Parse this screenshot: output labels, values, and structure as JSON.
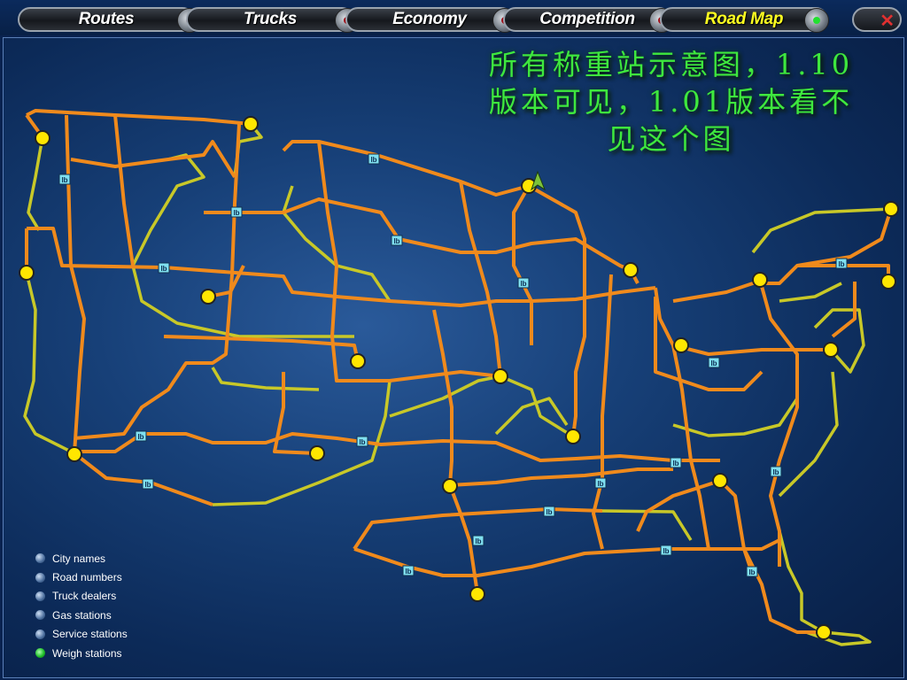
{
  "nav": {
    "tabs": [
      {
        "label": "Routes",
        "active": false
      },
      {
        "label": "Trucks",
        "active": false
      },
      {
        "label": "Economy",
        "active": false
      },
      {
        "label": "Competition",
        "active": false
      },
      {
        "label": "Road Map",
        "active": true
      }
    ],
    "close_icon": "close-icon"
  },
  "map": {
    "note": "所有称重站示意图，1.10版本可见，1.01版本看不见这个图",
    "weigh_label": "lb",
    "colors": {
      "interstate": "#f08a1c",
      "highway": "#c8c828",
      "city": "#ffe600",
      "weigh": "#7fe0f0"
    }
  },
  "legend": {
    "items": [
      {
        "label": "City names",
        "on": false
      },
      {
        "label": "Road numbers",
        "on": false
      },
      {
        "label": "Truck dealers",
        "on": false
      },
      {
        "label": "Gas stations",
        "on": false
      },
      {
        "label": "Service stations",
        "on": false
      },
      {
        "label": "Weigh stations",
        "on": true
      }
    ]
  }
}
